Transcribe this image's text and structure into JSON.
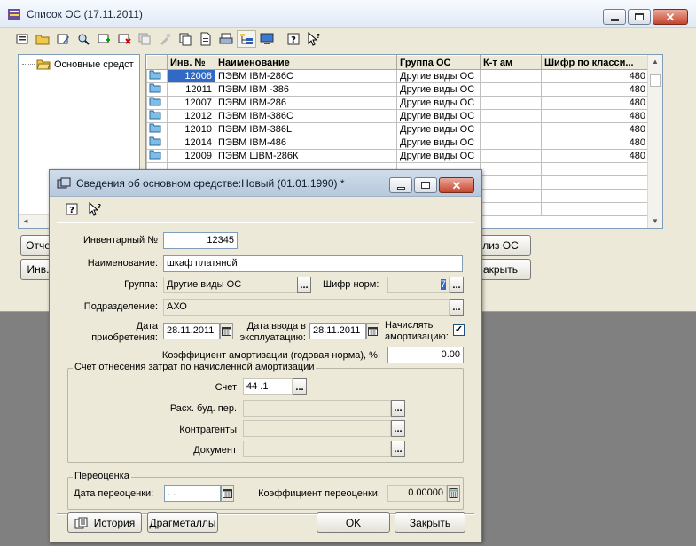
{
  "main_window": {
    "title": "Список ОС (17.11.2011)",
    "tree": {
      "root_label": "Основные средст"
    },
    "grid": {
      "columns": [
        "",
        "Инв. №",
        "Наименование",
        "Группа ОС",
        "К-т ам",
        "Шифр по класси..."
      ],
      "rows": [
        {
          "inv": "12008",
          "name": "ПЭВМ IBM-286C",
          "group": "Другие виды ОС",
          "k": "",
          "code": "480"
        },
        {
          "inv": "12011",
          "name": "ПЭВМ IBM -386",
          "group": "Другие виды ОС",
          "k": "",
          "code": "480"
        },
        {
          "inv": "12007",
          "name": "ПЭВМ IBM-286",
          "group": "Другие виды ОС",
          "k": "",
          "code": "480"
        },
        {
          "inv": "12012",
          "name": "ПЭВМ IBM-386C",
          "group": "Другие виды ОС",
          "k": "",
          "code": "480"
        },
        {
          "inv": "12010",
          "name": "ПЭВМ IBM-386L",
          "group": "Другие виды ОС",
          "k": "",
          "code": "480"
        },
        {
          "inv": "12014",
          "name": "ПЭВМ IBM-486",
          "group": "Другие виды ОС",
          "k": "",
          "code": "480"
        },
        {
          "inv": "12009",
          "name": "ПЭВМ ШВМ-286К",
          "group": "Другие виды ОС",
          "k": "",
          "code": "480"
        }
      ]
    },
    "buttons": {
      "otch": "Отче",
      "inv": "Инв.",
      "analiz": "лиз ОС",
      "close": "акрыть"
    }
  },
  "dialog": {
    "title": "Сведения об основном средстве:Новый (01.01.1990) *",
    "fields": {
      "inv_label": "Инвентарный №",
      "inv_value": "12345",
      "name_label": "Наименование:",
      "name_value": "шкаф платяной",
      "group_label": "Группа:",
      "group_value": "Другие виды ОС",
      "cipher_label": "Шифр норм:",
      "cipher_value": "7",
      "dept_label": "Подразделение:",
      "dept_value": "АХО",
      "acq_label_1": "Дата",
      "acq_label_2": "приобретения:",
      "acq_value": "28.11.2011",
      "commission_label_1": "Дата ввода в",
      "commission_label_2": "эксплуатацию:",
      "commission_value": "28.11.2011",
      "amort_label_1": "Начислять",
      "amort_label_2": "амортизацию:",
      "amort_checked": true,
      "rate_label": "Коэффициент амортизации (годовая норма), %:",
      "rate_value": "0.00"
    },
    "expense_group": {
      "title": "Счет отнесения затрат по начисленной амортизации",
      "account_label": "Счет",
      "account_value": "44 .1",
      "budget_label": "Расх. буд. пер.",
      "budget_value": "",
      "contractors_label": "Контрагенты",
      "contractors_value": "",
      "document_label": "Документ",
      "document_value": ""
    },
    "revaluation_group": {
      "title": "Переоценка",
      "date_label": "Дата переоценки:",
      "date_value": " .  .",
      "coef_label": "Коэффициент переоценки:",
      "coef_value": "0.00000"
    },
    "buttons": {
      "history": "История",
      "metals": "Драгметаллы",
      "ok": "OK",
      "close": "Закрыть"
    }
  },
  "colors": {
    "selection": "#316ac5",
    "window_bg": "#ece9d8",
    "desktop": "#808080"
  }
}
